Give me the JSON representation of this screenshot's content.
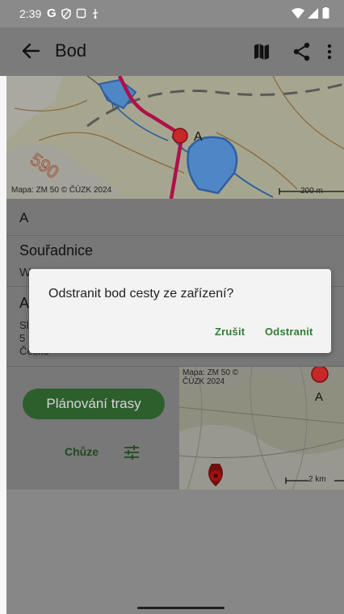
{
  "status_bar": {
    "time": "2:39"
  },
  "app_bar": {
    "title": "Bod"
  },
  "map_top": {
    "waypoint_label": "A",
    "contour_label": "590",
    "credit": "Mapa: ZM 50 © ČÚZK 2024",
    "scale": "200 m"
  },
  "detail": {
    "name": "A",
    "coords_heading": "Souřadnice",
    "coords_value": "W",
    "address_heading": "A",
    "address_lines": [
      "Sl",
      "5",
      "Česko"
    ]
  },
  "route": {
    "plan_button": "Plánování trasy",
    "mode": "Chůze"
  },
  "map_small": {
    "credit_line1": "Mapa: ZM 50 ©",
    "credit_line2": "ČÚZK 2024",
    "waypoint_label": "A",
    "scale": "2 km"
  },
  "dialog": {
    "message": "Odstranit bod cesty ze zařízení?",
    "cancel": "Zrušit",
    "confirm": "Odstranit"
  },
  "colors": {
    "accent": "#2e7d32",
    "route": "#c2185b",
    "marker": "#d32f2f",
    "water": "#4f86c6"
  }
}
